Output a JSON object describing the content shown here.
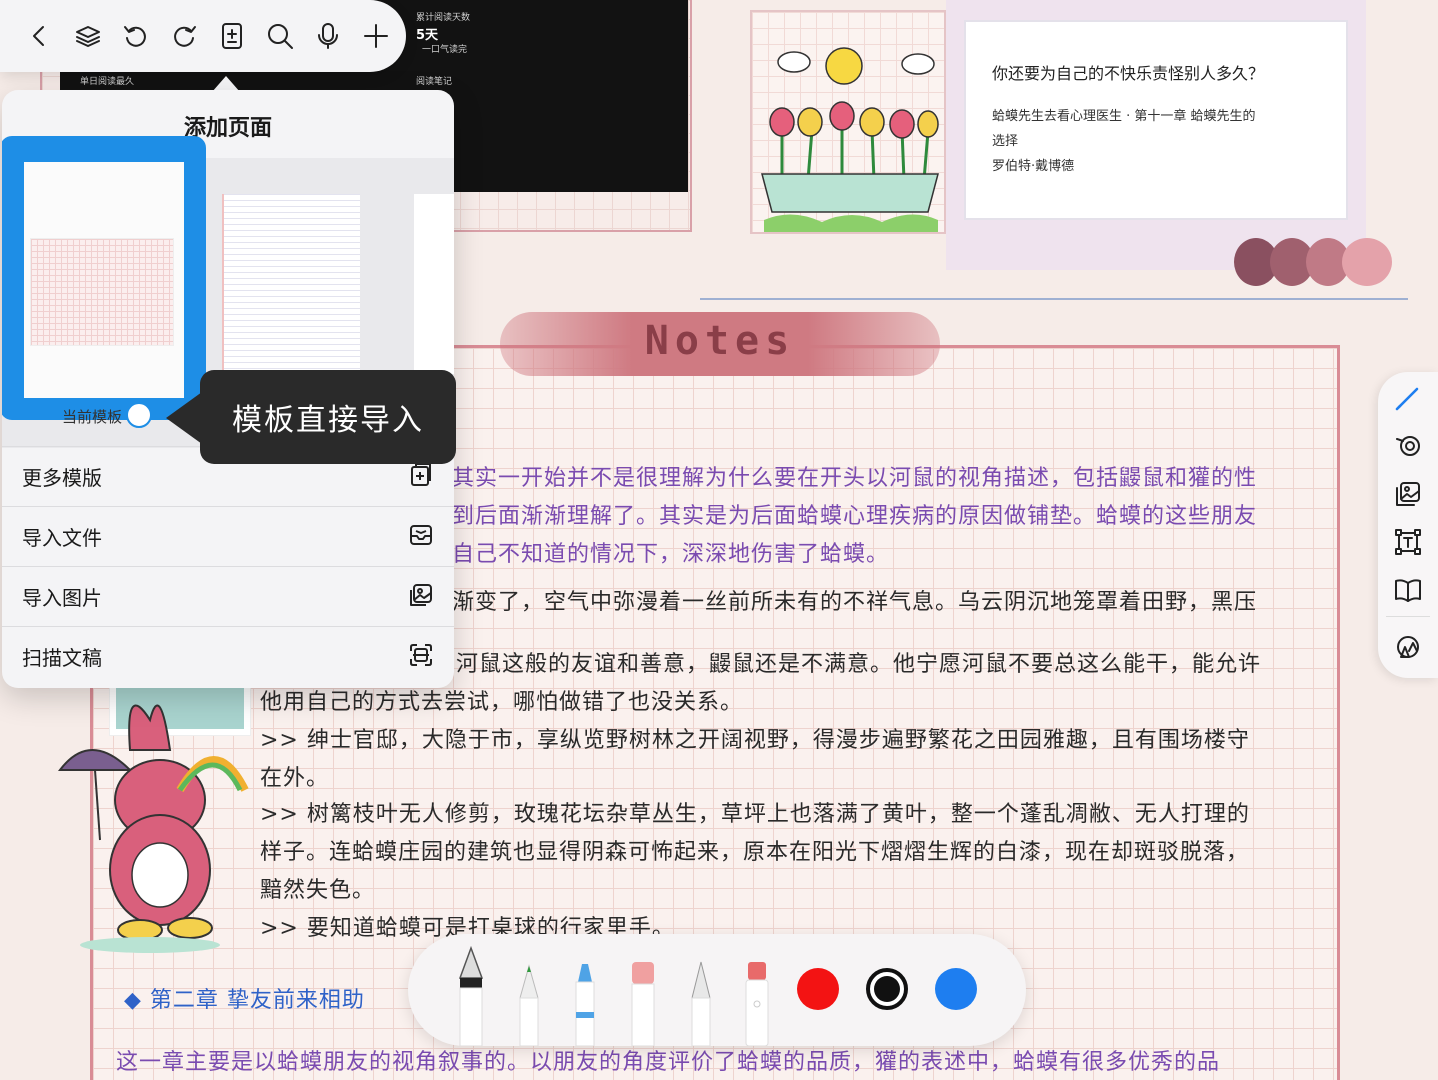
{
  "background": {
    "dark_panel": {
      "label_reading_days": "累计阅读天数",
      "reading_days_value": "5天",
      "label_one_breath": "一口气读完",
      "label_daily_longest": "单日阅读最久",
      "label_reading_notes": "阅读笔记"
    },
    "quote_card": {
      "title": "你还要为自己的不快乐责怪别人多久？",
      "source": "蛤蟆先生去看心理医生 · 第十一章 蛤蟆先生的",
      "source_cont": "选择",
      "author": "罗伯特·戴博德"
    },
    "notes_title": "Notes",
    "handwriting": {
      "line1": "其实一开始并不是很理解为什么要在开头以河鼠的视角描述，包括鼹鼠和獾的性",
      "line2": "到后面渐渐理解了。其实是为后面蛤蟆心理疾病的原因做铺垫。蛤蟆的这些朋友",
      "line3": "自己不知道的情况下，深深地伤害了蛤蟆。",
      "line4": "渐变了，空气中弥漫着一丝前所未有的不祥气息。乌云阴沉地笼罩着田野，黑压",
      "line5": "河鼠这般的友谊和善意，鼹鼠还是不满意。他宁愿河鼠不要总这么能干，能允许",
      "line6": "他用自己的方式去尝试，哪怕做错了也没关系。",
      "line7": ">> 绅士官邸，大隐于市，享纵览野树林之开阔视野，得漫步遍野繁花之田园雅趣，且有围场楼守",
      "line8": "在外。",
      "line9": ">> 树篱枝叶无人修剪，玫瑰花坛杂草丛生，草坪上也落满了黄叶，整一个蓬乱凋敝、无人打理的",
      "line10": "样子。连蛤蟆庄园的建筑也显得阴森可怖起来，原本在阳光下熠熠生辉的白漆，现在却斑驳脱落，",
      "line11": "黯然失色。",
      "line12": ">> 要知道蛤蟆可是打桌球的行家里手。",
      "chapter": "◆ 第二章 挚友前来相助",
      "last_line": "这一章主要是以蛤蟆朋友的视角叙事的。以朋友的角度评价了蛤蟆的品质，獾的表述中，蛤蟆有很多优秀的品"
    }
  },
  "top_toolbar": {
    "buttons": [
      "back-icon",
      "layers-icon",
      "undo-icon",
      "redo-icon",
      "add-page-icon",
      "search-icon",
      "microphone-icon",
      "plus-icon"
    ]
  },
  "popover": {
    "title": "添加页面",
    "current_template_label": "当前模板",
    "tooltip": "模板直接导入",
    "menu": [
      {
        "label": "更多模版",
        "icon": "template-plus-icon"
      },
      {
        "label": "导入文件",
        "icon": "import-file-icon"
      },
      {
        "label": "导入图片",
        "icon": "image-icon"
      },
      {
        "label": "扫描文稿",
        "icon": "scan-icon"
      }
    ]
  },
  "right_tools": [
    "pen-icon",
    "lasso-icon",
    "image-icon",
    "text-box-icon",
    "book-icon",
    "shapes-icon"
  ],
  "pen_tray": {
    "tools": [
      "fountain-pen",
      "pencil",
      "marker",
      "eraser",
      "ruler-pen",
      "highlighter"
    ],
    "colors": [
      "#f31313",
      "#111111",
      "#1e7ef0"
    ]
  },
  "colors": {
    "accent_blue": "#1e8ee6",
    "handwriting_purple": "#7a4bb0",
    "banner_pink": "#cf7a82"
  }
}
